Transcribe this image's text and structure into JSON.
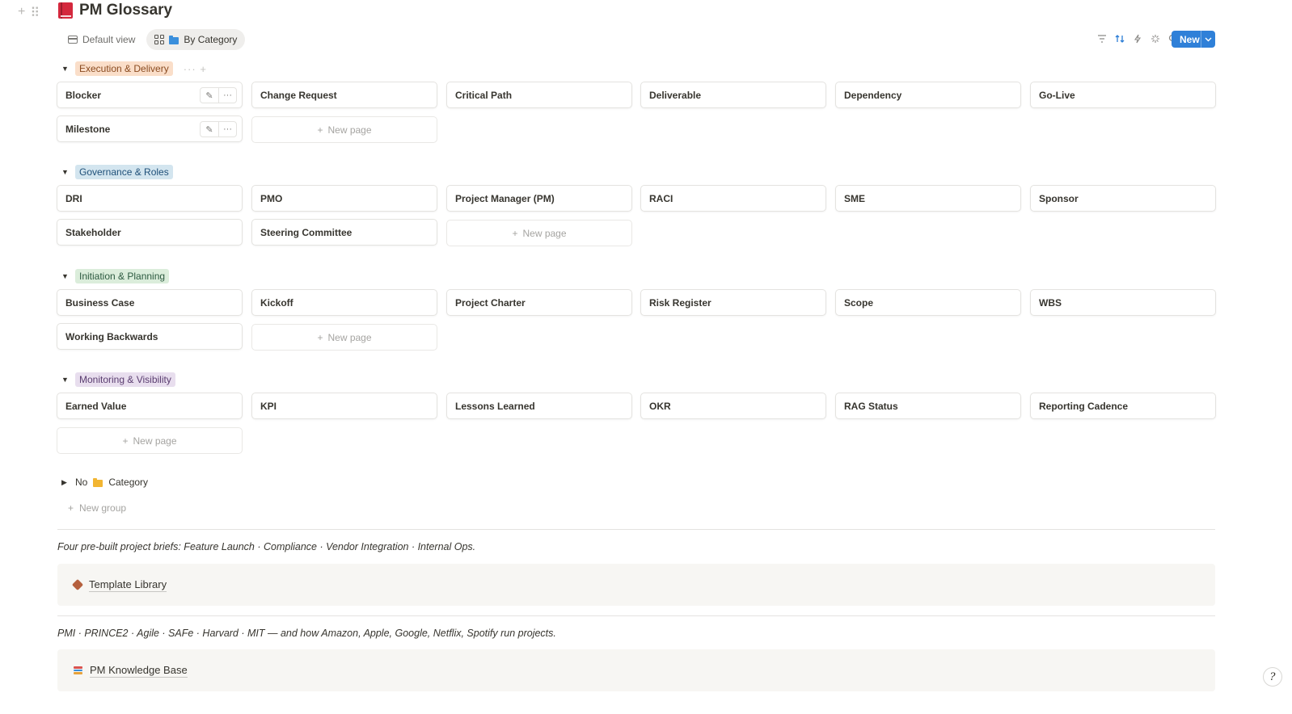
{
  "page": {
    "title": "PM Glossary",
    "icon": "red-book-icon"
  },
  "views": [
    {
      "label": "Default view",
      "icon": "table-icon",
      "active": false
    },
    {
      "label": "By Category",
      "icon": "board-icon",
      "active": true
    }
  ],
  "toolbar": {
    "icons": [
      "filter-icon",
      "sort-icon",
      "lightning-icon",
      "sparkle-icon",
      "search-icon",
      "expand-icon",
      "settings-icon"
    ],
    "new_label": "New"
  },
  "groups": [
    {
      "label": "Execution & Delivery",
      "color_bg": "#fadec9",
      "color_fg": "#8a4b20",
      "cards": [
        "Blocker",
        "Change Request",
        "Critical Path",
        "Deliverable",
        "Dependency",
        "Go-Live",
        "Milestone"
      ],
      "new_page": "New page"
    },
    {
      "label": "Governance & Roles",
      "color_bg": "#d3e5ef",
      "color_fg": "#1f5079",
      "cards": [
        "DRI",
        "PMO",
        "Project Manager (PM)",
        "RACI",
        "SME",
        "Sponsor",
        "Stakeholder",
        "Steering Committee"
      ],
      "new_page": "New page"
    },
    {
      "label": "Initiation & Planning",
      "color_bg": "#dbeddb",
      "color_fg": "#2b593f",
      "cards": [
        "Business Case",
        "Kickoff",
        "Project Charter",
        "Risk Register",
        "Scope",
        "WBS",
        "Working Backwards"
      ],
      "new_page": "New page"
    },
    {
      "label": "Monitoring & Visibility",
      "color_bg": "#e8deee",
      "color_fg": "#5a3d70",
      "cards": [
        "Earned Value",
        "KPI",
        "Lessons Learned",
        "OKR",
        "RAG Status",
        "Reporting Cadence"
      ],
      "new_page": "New page"
    }
  ],
  "no_category": {
    "prefix": "No",
    "label": "Category"
  },
  "new_group": "New group",
  "section1": {
    "text": "Four pre-built project briefs: Feature Launch · Compliance · Vendor Integration · Internal Ops.",
    "link": "Template Library"
  },
  "section2": {
    "text": "PMI · PRINCE2 · Agile · SAFe · Harvard · MIT — and how Amazon, Apple, Google, Netflix, Spotify run projects.",
    "link": "PM Knowledge Base"
  },
  "help_label": "?"
}
